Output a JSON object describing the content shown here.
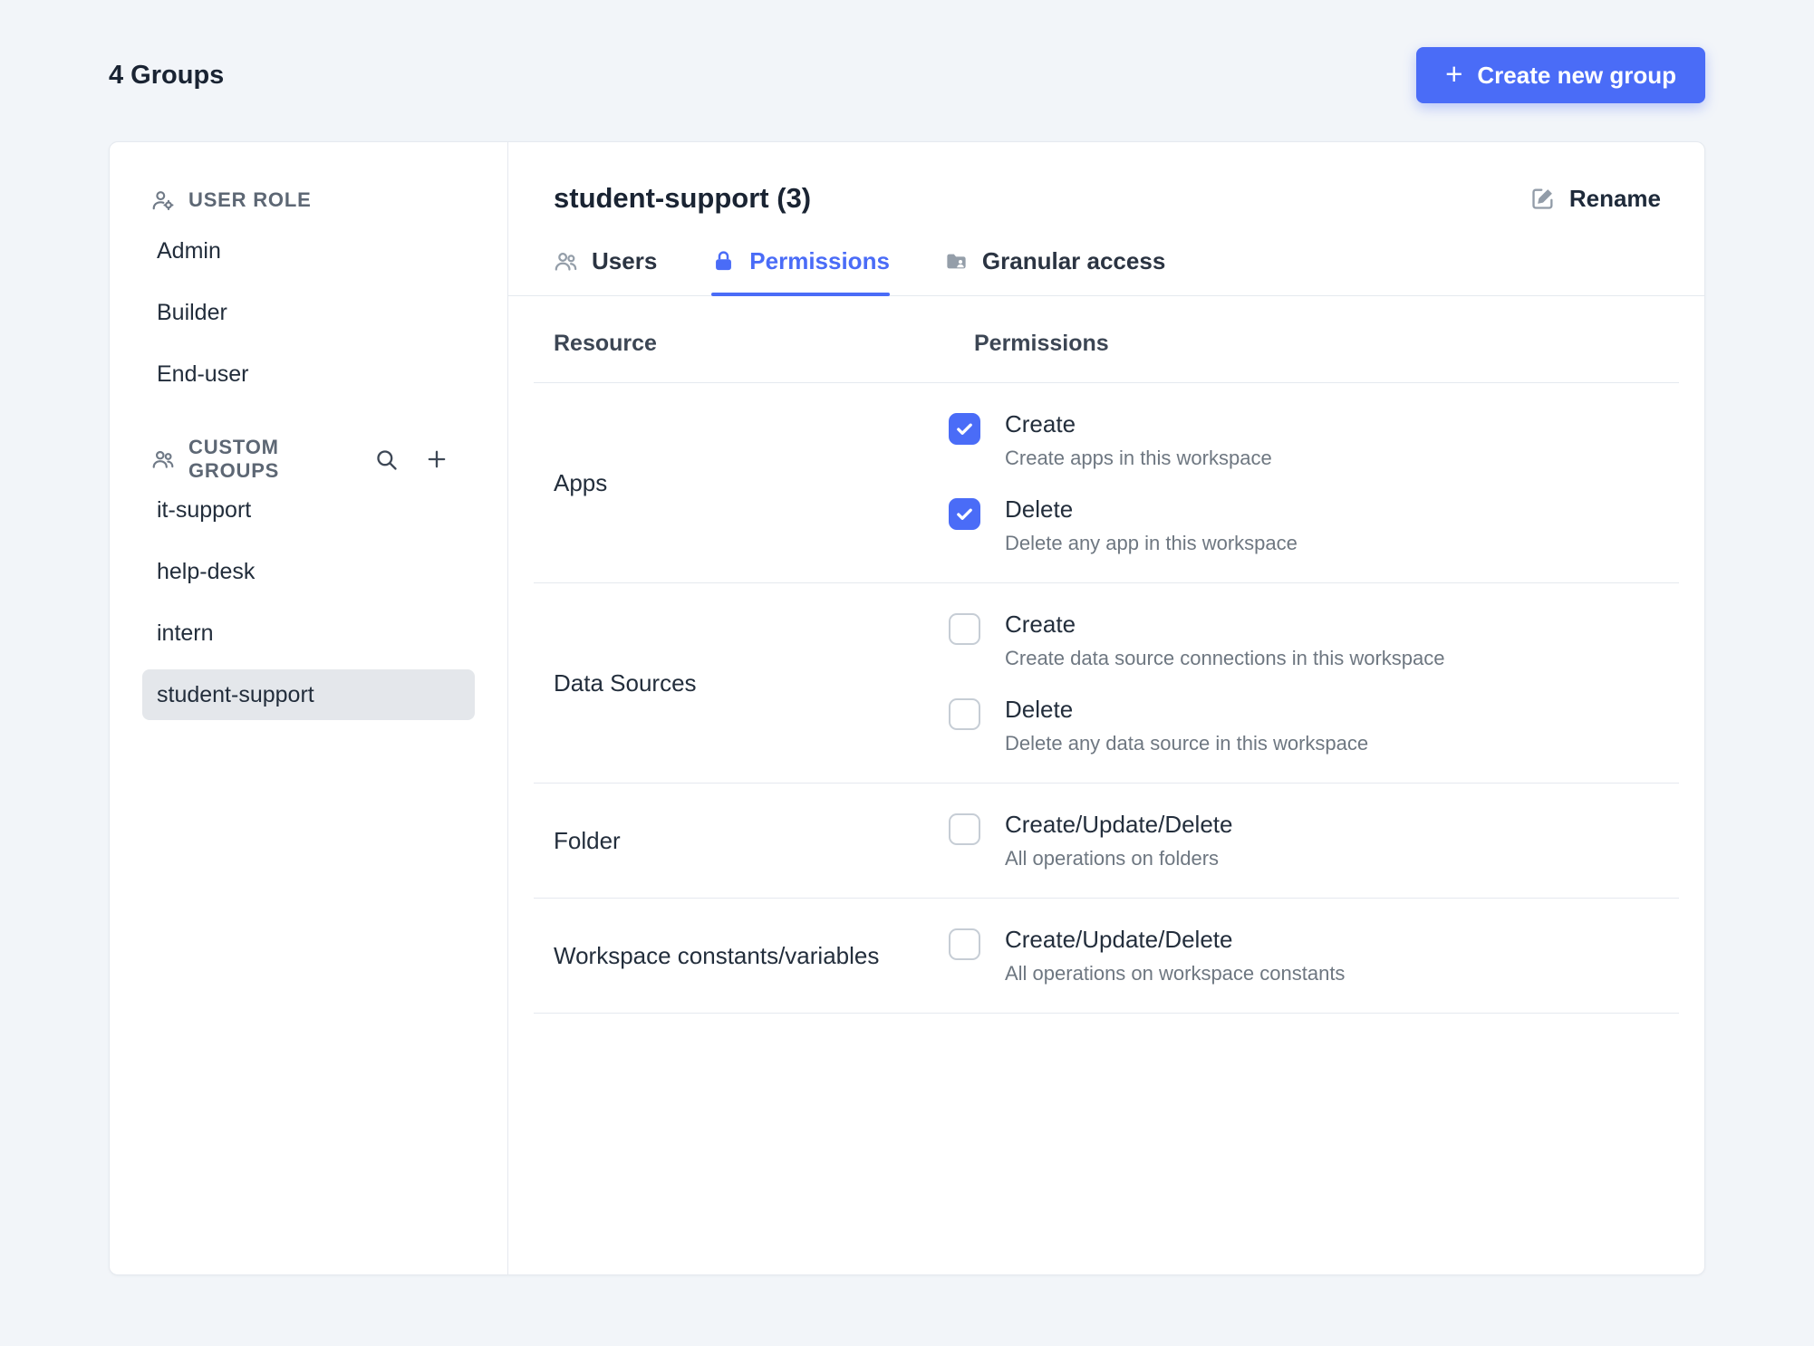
{
  "header": {
    "title": "4 Groups",
    "create_button_label": "Create new group"
  },
  "sidebar": {
    "user_role": {
      "label": "USER ROLE",
      "items": [
        "Admin",
        "Builder",
        "End-user"
      ]
    },
    "custom_groups": {
      "label": "CUSTOM GROUPS",
      "items": [
        "it-support",
        "help-desk",
        "intern",
        "student-support"
      ],
      "selected": "student-support"
    }
  },
  "panel": {
    "title": "student-support (3)",
    "rename_label": "Rename",
    "tabs": [
      {
        "label": "Users",
        "active": false
      },
      {
        "label": "Permissions",
        "active": true
      },
      {
        "label": "Granular access",
        "active": false
      }
    ],
    "table": {
      "headers": {
        "resource": "Resource",
        "permissions": "Permissions"
      },
      "rows": [
        {
          "resource": "Apps",
          "permissions": [
            {
              "label": "Create",
              "description": "Create apps in this workspace",
              "checked": true
            },
            {
              "label": "Delete",
              "description": "Delete any app in this workspace",
              "checked": true
            }
          ]
        },
        {
          "resource": "Data Sources",
          "permissions": [
            {
              "label": "Create",
              "description": "Create data source connections in this workspace",
              "checked": false
            },
            {
              "label": "Delete",
              "description": "Delete any data source in this workspace",
              "checked": false
            }
          ]
        },
        {
          "resource": "Folder",
          "permissions": [
            {
              "label": "Create/Update/Delete",
              "description": "All operations on folders",
              "checked": false
            }
          ]
        },
        {
          "resource": "Workspace constants/variables",
          "permissions": [
            {
              "label": "Create/Update/Delete",
              "description": "All operations on workspace constants",
              "checked": false
            }
          ]
        }
      ]
    }
  },
  "theme": {
    "accent": "#4a6cf7",
    "selected_item_bg": "#e4e7eb",
    "card_border": "#e5e9ef",
    "page_background": "#f2f5f9"
  }
}
